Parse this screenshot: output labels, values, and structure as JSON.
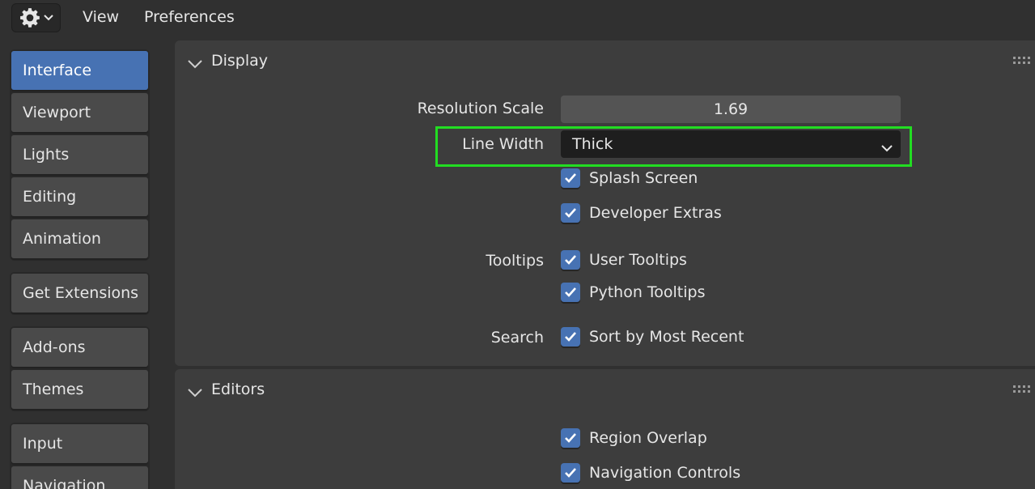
{
  "topbar": {
    "editor_icon": "gear-icon",
    "menu": [
      "View",
      "Preferences"
    ]
  },
  "sidebar": {
    "groups": [
      [
        "Interface",
        "Viewport",
        "Lights",
        "Editing",
        "Animation"
      ],
      [
        "Get Extensions"
      ],
      [
        "Add-ons",
        "Themes"
      ],
      [
        "Input",
        "Navigation"
      ]
    ],
    "active": "Interface"
  },
  "display_panel": {
    "title": "Display",
    "resolution_scale": {
      "label": "Resolution Scale",
      "value": "1.69"
    },
    "line_width": {
      "label": "Line Width",
      "value": "Thick"
    },
    "splash_screen": {
      "label": "Splash Screen",
      "checked": true
    },
    "developer_extras": {
      "label": "Developer Extras",
      "checked": true
    },
    "tooltips": {
      "label": "Tooltips",
      "user": {
        "label": "User Tooltips",
        "checked": true
      },
      "python": {
        "label": "Python Tooltips",
        "checked": true
      }
    },
    "search": {
      "label": "Search",
      "sort_recent": {
        "label": "Sort by Most Recent",
        "checked": true
      }
    }
  },
  "editors_panel": {
    "title": "Editors",
    "region_overlap": {
      "label": "Region Overlap",
      "checked": true
    },
    "navigation_controls": {
      "label": "Navigation Controls",
      "checked": true
    }
  },
  "colors": {
    "accent": "#4772b3",
    "highlight_box": "#22dd22",
    "panel": "#3d3d3d",
    "background": "#303030"
  }
}
